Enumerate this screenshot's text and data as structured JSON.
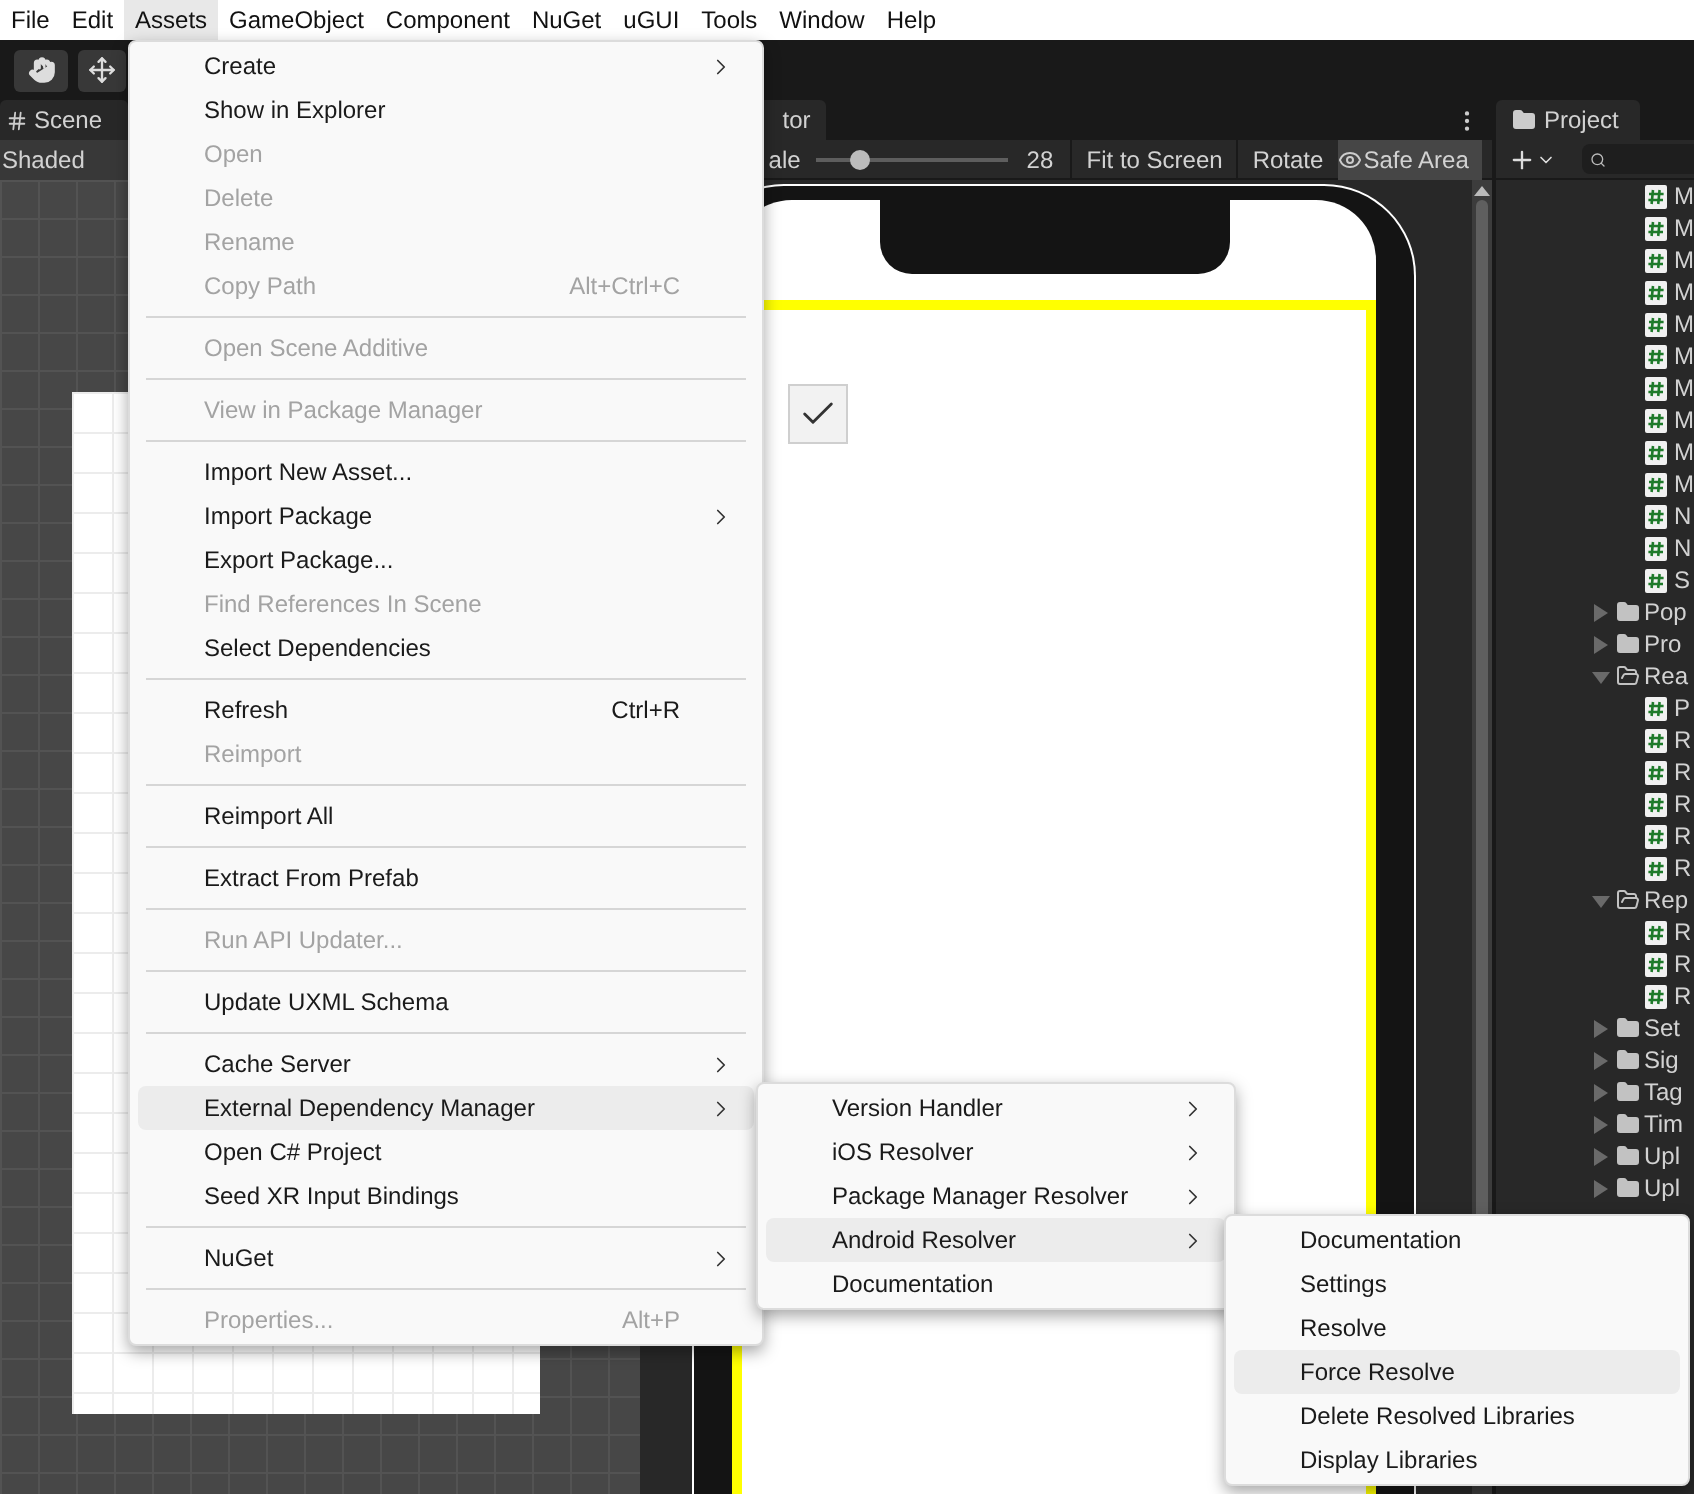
{
  "menu_bar": [
    {
      "label": "File",
      "selected": false
    },
    {
      "label": "Edit",
      "selected": false
    },
    {
      "label": "Assets",
      "selected": true
    },
    {
      "label": "GameObject",
      "selected": false
    },
    {
      "label": "Component",
      "selected": false
    },
    {
      "label": "NuGet",
      "selected": false
    },
    {
      "label": "uGUI",
      "selected": false
    },
    {
      "label": "Tools",
      "selected": false
    },
    {
      "label": "Window",
      "selected": false
    },
    {
      "label": "Help",
      "selected": false
    }
  ],
  "scene": {
    "tab": "Scene",
    "mode": "Shaded"
  },
  "game": {
    "tab": "tor",
    "scale_label": "ale",
    "scale": {
      "level": 0.23
    },
    "scale_value": "28",
    "buttons": [
      "Fit to Screen",
      "Rotate"
    ],
    "safe_area": {
      "label": "Safe Area",
      "on": true
    },
    "toggle": {
      "checked": true
    }
  },
  "project": {
    "tab": "Project",
    "tree": [
      {
        "kind": "script",
        "label": "M"
      },
      {
        "kind": "script",
        "label": "M"
      },
      {
        "kind": "script",
        "label": "M"
      },
      {
        "kind": "script",
        "label": "M"
      },
      {
        "kind": "script",
        "label": "M"
      },
      {
        "kind": "script",
        "label": "M"
      },
      {
        "kind": "script",
        "label": "M"
      },
      {
        "kind": "script",
        "label": "M"
      },
      {
        "kind": "script",
        "label": "M"
      },
      {
        "kind": "script",
        "label": "M"
      },
      {
        "kind": "script",
        "label": "N"
      },
      {
        "kind": "script",
        "label": "N"
      },
      {
        "kind": "script",
        "label": "S"
      },
      {
        "kind": "folder",
        "label": "Pop",
        "expanded": false
      },
      {
        "kind": "folder",
        "label": "Pro",
        "expanded": false
      },
      {
        "kind": "folder",
        "label": "Rea",
        "expanded": true,
        "children": [
          {
            "kind": "script",
            "label": "P"
          },
          {
            "kind": "script",
            "label": "R"
          },
          {
            "kind": "script",
            "label": "R"
          },
          {
            "kind": "script",
            "label": "R"
          },
          {
            "kind": "script",
            "label": "R"
          },
          {
            "kind": "script",
            "label": "R"
          }
        ]
      },
      {
        "kind": "folder",
        "label": "Rep",
        "expanded": true,
        "children": [
          {
            "kind": "script",
            "label": "R"
          },
          {
            "kind": "script",
            "label": "R"
          },
          {
            "kind": "script",
            "label": "R"
          }
        ]
      },
      {
        "kind": "folder",
        "label": "Set",
        "expanded": false
      },
      {
        "kind": "folder",
        "label": "Sig",
        "expanded": false
      },
      {
        "kind": "folder",
        "label": "Tag",
        "expanded": false
      },
      {
        "kind": "folder",
        "label": "Tim",
        "expanded": false
      },
      {
        "kind": "folder",
        "label": "Upl",
        "expanded": false
      },
      {
        "kind": "folder",
        "label": "Upl",
        "expanded": false
      }
    ]
  },
  "assets_menu": [
    {
      "kind": "item",
      "label": "Create",
      "submenu": true,
      "disabled": false,
      "selected": false
    },
    {
      "kind": "item",
      "label": "Show in Explorer",
      "submenu": false,
      "disabled": false,
      "selected": false
    },
    {
      "kind": "item",
      "label": "Open",
      "submenu": false,
      "disabled": true,
      "selected": false
    },
    {
      "kind": "item",
      "label": "Delete",
      "submenu": false,
      "disabled": true,
      "selected": false
    },
    {
      "kind": "item",
      "label": "Rename",
      "submenu": false,
      "disabled": true,
      "selected": false
    },
    {
      "kind": "item",
      "label": "Copy Path",
      "shortcut": "Alt+Ctrl+C",
      "submenu": false,
      "disabled": true,
      "selected": false
    },
    {
      "kind": "separator"
    },
    {
      "kind": "item",
      "label": "Open Scene Additive",
      "submenu": false,
      "disabled": true,
      "selected": false
    },
    {
      "kind": "separator"
    },
    {
      "kind": "item",
      "label": "View in Package Manager",
      "submenu": false,
      "disabled": true,
      "selected": false
    },
    {
      "kind": "separator"
    },
    {
      "kind": "item",
      "label": "Import New Asset...",
      "submenu": false,
      "disabled": false,
      "selected": false
    },
    {
      "kind": "item",
      "label": "Import Package",
      "submenu": true,
      "disabled": false,
      "selected": false
    },
    {
      "kind": "item",
      "label": "Export Package...",
      "submenu": false,
      "disabled": false,
      "selected": false
    },
    {
      "kind": "item",
      "label": "Find References In Scene",
      "submenu": false,
      "disabled": true,
      "selected": false
    },
    {
      "kind": "item",
      "label": "Select Dependencies",
      "submenu": false,
      "disabled": false,
      "selected": false
    },
    {
      "kind": "separator"
    },
    {
      "kind": "item",
      "label": "Refresh",
      "shortcut": "Ctrl+R",
      "submenu": false,
      "disabled": false,
      "selected": false
    },
    {
      "kind": "item",
      "label": "Reimport",
      "submenu": false,
      "disabled": true,
      "selected": false
    },
    {
      "kind": "separator"
    },
    {
      "kind": "item",
      "label": "Reimport All",
      "submenu": false,
      "disabled": false,
      "selected": false
    },
    {
      "kind": "separator"
    },
    {
      "kind": "item",
      "label": "Extract From Prefab",
      "submenu": false,
      "disabled": false,
      "selected": false
    },
    {
      "kind": "separator"
    },
    {
      "kind": "item",
      "label": "Run API Updater...",
      "submenu": false,
      "disabled": true,
      "selected": false
    },
    {
      "kind": "separator"
    },
    {
      "kind": "item",
      "label": "Update UXML Schema",
      "submenu": false,
      "disabled": false,
      "selected": false
    },
    {
      "kind": "separator"
    },
    {
      "kind": "item",
      "label": "Cache Server",
      "submenu": true,
      "disabled": false,
      "selected": false
    },
    {
      "kind": "item",
      "label": "External Dependency Manager",
      "submenu": true,
      "disabled": false,
      "selected": true
    },
    {
      "kind": "item",
      "label": "Open C# Project",
      "submenu": false,
      "disabled": false,
      "selected": false
    },
    {
      "kind": "item",
      "label": "Seed XR Input Bindings",
      "submenu": false,
      "disabled": false,
      "selected": false
    },
    {
      "kind": "separator"
    },
    {
      "kind": "item",
      "label": "NuGet",
      "submenu": true,
      "disabled": false,
      "selected": false
    },
    {
      "kind": "separator"
    },
    {
      "kind": "item",
      "label": "Properties...",
      "shortcut": "Alt+P",
      "submenu": false,
      "disabled": true,
      "selected": false
    }
  ],
  "dependency_menu": [
    {
      "kind": "item",
      "label": "Version Handler",
      "submenu": true,
      "disabled": false,
      "selected": false
    },
    {
      "kind": "item",
      "label": "iOS Resolver",
      "submenu": true,
      "disabled": false,
      "selected": false
    },
    {
      "kind": "item",
      "label": "Package Manager Resolver",
      "submenu": true,
      "disabled": false,
      "selected": false
    },
    {
      "kind": "item",
      "label": "Android Resolver",
      "submenu": true,
      "disabled": false,
      "selected": true
    },
    {
      "kind": "item",
      "label": "Documentation",
      "submenu": false,
      "disabled": false,
      "selected": false
    }
  ],
  "android_menu": [
    {
      "kind": "item",
      "label": "Documentation",
      "submenu": false,
      "disabled": false,
      "selected": false
    },
    {
      "kind": "item",
      "label": "Settings",
      "submenu": false,
      "disabled": false,
      "selected": false
    },
    {
      "kind": "item",
      "label": "Resolve",
      "submenu": false,
      "disabled": false,
      "selected": false
    },
    {
      "kind": "item",
      "label": "Force Resolve",
      "submenu": false,
      "disabled": false,
      "selected": true
    },
    {
      "kind": "item",
      "label": "Delete Resolved Libraries",
      "submenu": false,
      "disabled": false,
      "selected": false
    },
    {
      "kind": "item",
      "label": "Display Libraries",
      "submenu": false,
      "disabled": false,
      "selected": false
    }
  ]
}
